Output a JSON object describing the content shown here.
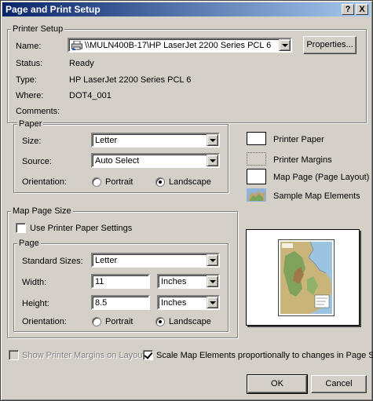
{
  "window": {
    "title": "Page and Print Setup",
    "help_btn": "?",
    "close_btn": "X"
  },
  "printer_setup": {
    "group_label": "Printer Setup",
    "name_label": "Name:",
    "name_value": "\\\\MULN400B-17\\HP LaserJet 2200 Series PCL 6",
    "properties_button": "Properties...",
    "status_label": "Status:",
    "status_value": "Ready",
    "type_label": "Type:",
    "type_value": "HP LaserJet 2200 Series PCL 6",
    "where_label": "Where:",
    "where_value": "DOT4_001",
    "comments_label": "Comments:",
    "comments_value": ""
  },
  "paper": {
    "group_label": "Paper",
    "size_label": "Size:",
    "size_value": "Letter",
    "source_label": "Source:",
    "source_value": "Auto Select",
    "orientation_label": "Orientation:",
    "portrait_label": "Portrait",
    "landscape_label": "Landscape",
    "orientation_selected": "Landscape"
  },
  "legend": {
    "printer_paper": "Printer Paper",
    "printer_margins": "Printer Margins",
    "map_page": "Map Page (Page Layout)",
    "sample_map": "Sample Map Elements"
  },
  "map_page_size": {
    "group_label": "Map Page Size",
    "use_printer_paper_label": "Use Printer Paper Settings",
    "use_printer_paper_checked": false,
    "page_group_label": "Page",
    "standard_sizes_label": "Standard Sizes:",
    "standard_sizes_value": "Letter",
    "width_label": "Width:",
    "width_value": "11",
    "width_units": "Inches",
    "height_label": "Height:",
    "height_value": "8.5",
    "height_units": "Inches",
    "orientation_label": "Orientation:",
    "portrait_label": "Portrait",
    "landscape_label": "Landscape",
    "orientation_selected": "Landscape"
  },
  "options": {
    "show_margins_label": "Show Printer Margins on Layout",
    "show_margins_enabled": false,
    "scale_label": "Scale Map Elements proportionally to changes in Page Size",
    "scale_checked": true
  },
  "buttons": {
    "ok": "OK",
    "cancel": "Cancel"
  }
}
